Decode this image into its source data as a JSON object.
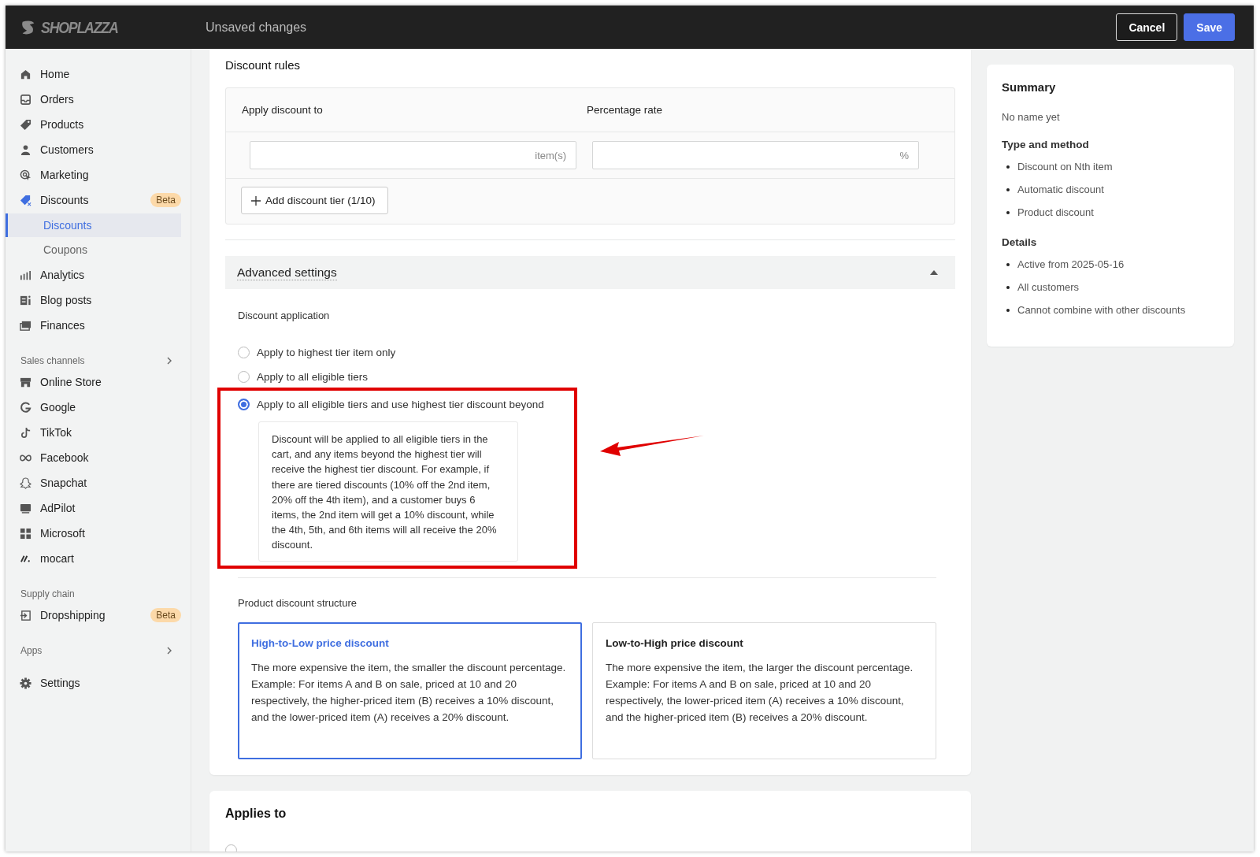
{
  "header": {
    "logo": "SHOPLAZZA",
    "title": "Unsaved changes",
    "buttons": [
      {
        "label": "Cancel",
        "kind": "secondary"
      },
      {
        "label": "Save",
        "kind": "primary"
      }
    ]
  },
  "sidebar": {
    "groups": [
      {
        "items": [
          {
            "label": "Home",
            "selected": false
          },
          {
            "label": "Orders",
            "selected": false
          },
          {
            "label": "Products",
            "selected": false
          },
          {
            "label": "Customers",
            "selected": false
          },
          {
            "label": "Marketing",
            "selected": false
          },
          {
            "label": "Discounts",
            "selected": false,
            "badge": "Beta",
            "children": [
              {
                "label": "Discounts",
                "selected": true
              },
              {
                "label": "Coupons",
                "selected": false
              }
            ]
          },
          {
            "label": "Analytics",
            "selected": false
          },
          {
            "label": "Blog posts",
            "selected": false
          },
          {
            "label": "Finances",
            "selected": false
          }
        ]
      },
      {
        "heading": "Sales channels",
        "collapsed": true,
        "items": [
          {
            "label": "Online Store",
            "selected": false
          },
          {
            "label": "Google",
            "selected": false
          },
          {
            "label": "TikTok",
            "selected": false
          },
          {
            "label": "Facebook",
            "selected": false
          },
          {
            "label": "Snapchat",
            "selected": false
          },
          {
            "label": "AdPilot",
            "selected": false
          },
          {
            "label": "Microsoft",
            "selected": false
          },
          {
            "label": "mocart",
            "selected": false
          }
        ]
      },
      {
        "heading": "Supply chain",
        "items": [
          {
            "label": "Dropshipping",
            "selected": false,
            "badge": "Beta"
          }
        ]
      },
      {
        "heading": "Apps",
        "collapsed": true
      },
      {
        "items": [
          {
            "label": "Settings",
            "selected": false
          }
        ]
      }
    ]
  },
  "discount_rules": {
    "title": "Discount rules",
    "columns": [
      "Apply discount to",
      "Percentage rate"
    ],
    "tiers": [
      {
        "quantity_suffix": "item(s)",
        "rate_suffix": "%"
      }
    ],
    "add_button": "Add discount tier (1/10)"
  },
  "advanced_settings": {
    "title": "Advanced settings",
    "expanded": true,
    "application": {
      "label": "Discount application",
      "options": [
        {
          "label": "Apply to highest tier item only",
          "selected": false
        },
        {
          "label": "Apply to all eligible tiers",
          "selected": false
        },
        {
          "label": "Apply to all eligible tiers and use highest tier discount beyond",
          "selected": true,
          "description": "Discount will be applied to all eligible tiers in the cart, and any items beyond the highest tier will receive the highest tier discount. For example, if there are tiered discounts (10% off the 2nd item, 20% off the 4th item), and a customer buys 6 items, the 2nd item will get a 10% discount, while the 4th, 5th, and 6th items will all receive the 20% discount."
        }
      ]
    },
    "structure": {
      "label": "Product discount structure",
      "options": [
        {
          "title": "High-to-Low price discount",
          "selected": true,
          "description": [
            "The more expensive the item, the smaller the discount percentage.",
            "Example: For items A and B on sale, priced at 10 and 20 respectively, the higher-priced item (B) receives a 10% discount, and the lower-priced item (A) receives a 20% discount."
          ]
        },
        {
          "title": "Low-to-High price discount",
          "selected": false,
          "description": [
            "The more expensive the item, the larger the discount percentage.",
            "Example: For items A and B on sale, priced at 10 and 20 respectively, the lower-priced item (A) receives a 10% discount, and the higher-priced item (B) receives a 20% discount."
          ]
        }
      ]
    }
  },
  "applies_to": {
    "title": "Applies to",
    "options": [
      {
        "selected": false
      }
    ]
  },
  "summary": {
    "title": "Summary",
    "name": "No name yet",
    "sections": [
      {
        "title": "Type and method",
        "items": [
          "Discount on Nth item",
          "Automatic discount",
          "Product discount"
        ]
      },
      {
        "title": "Details",
        "items": [
          "Active from 2025-05-16",
          "All customers",
          "Cannot combine with other discounts"
        ]
      }
    ]
  }
}
